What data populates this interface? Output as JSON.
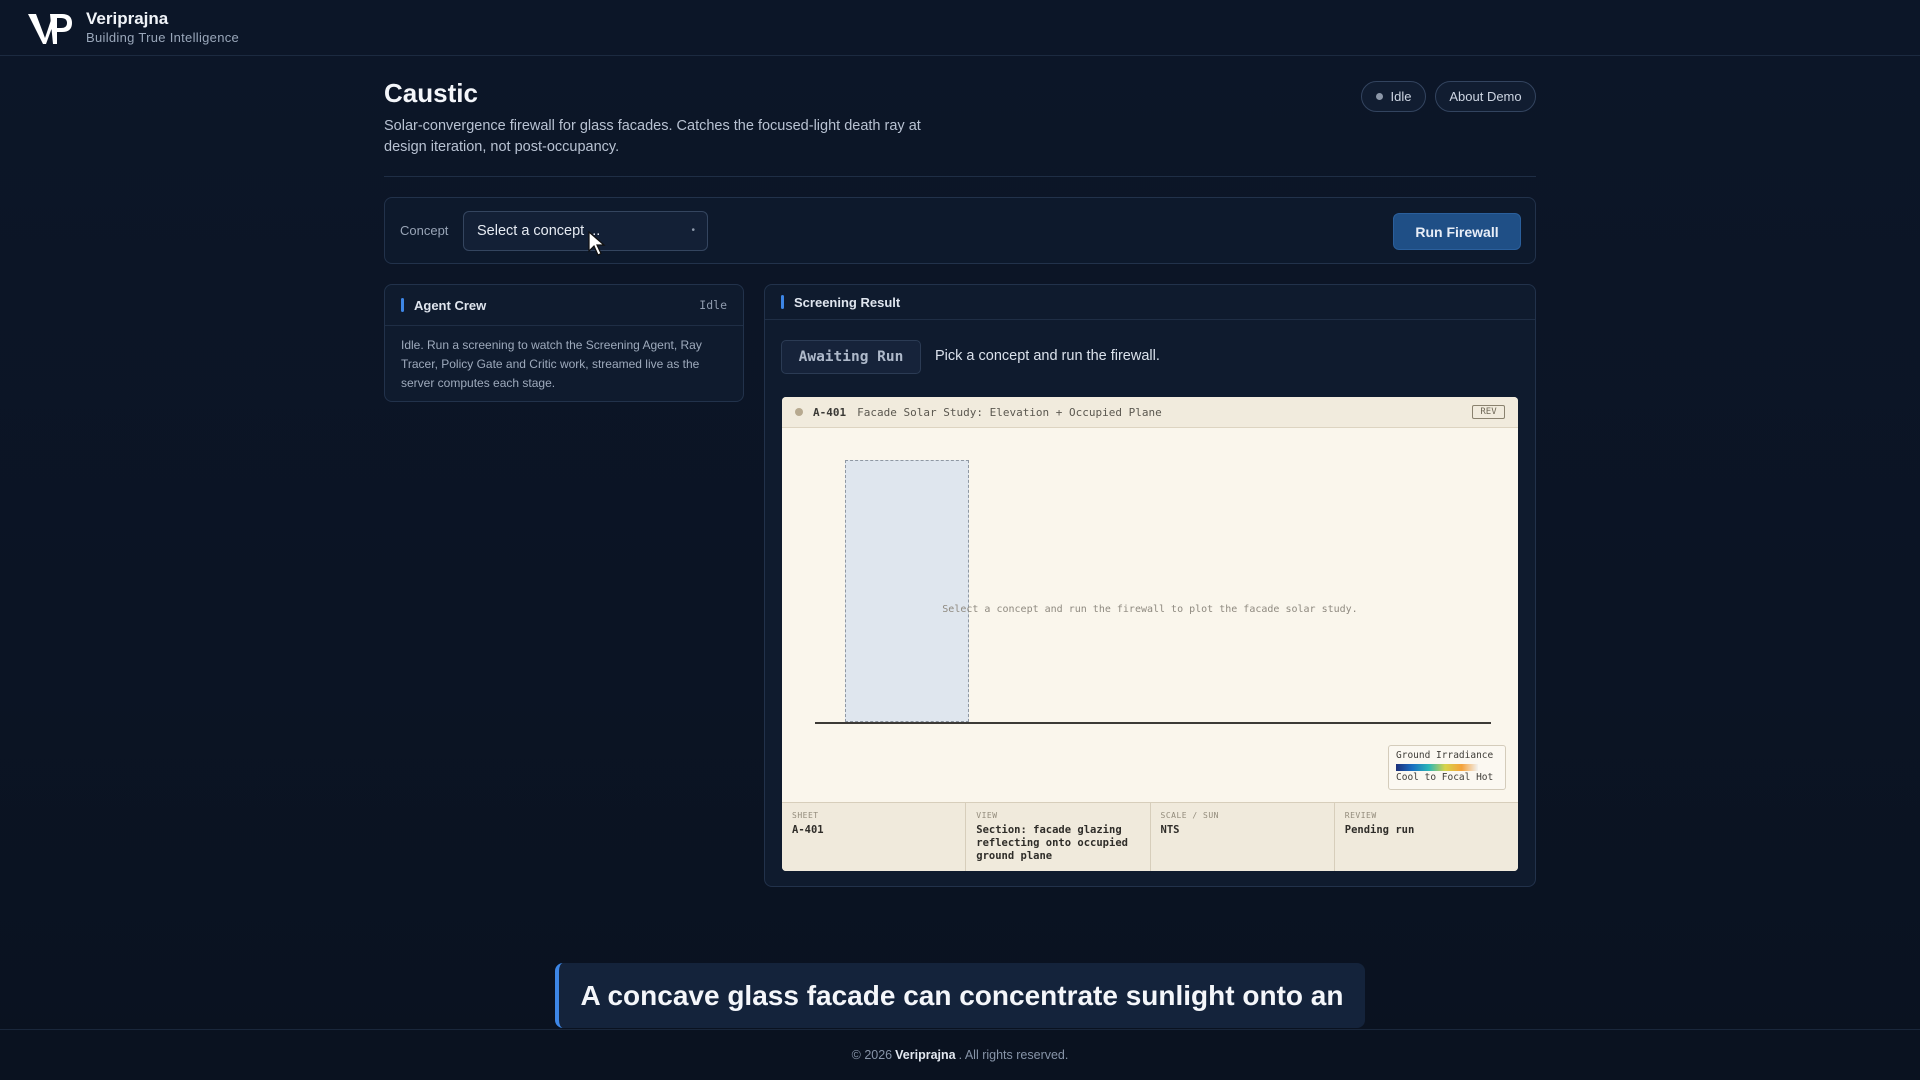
{
  "brand": {
    "name": "Veriprajna",
    "tagline": "Building True Intelligence"
  },
  "header": {
    "title": "Caustic",
    "description": "Solar-convergence firewall for glass facades. Catches the focused-light death ray at design iteration, not post-occupancy.",
    "status": "Idle",
    "about_label": "About Demo"
  },
  "concept": {
    "label": "Concept",
    "placeholder": "Select a concept ...",
    "run_label": "Run Firewall"
  },
  "agent_crew": {
    "title": "Agent Crew",
    "state": "Idle",
    "body": "Idle. Run a screening to watch the Screening Agent, Ray Tracer, Policy Gate and Critic work, streamed live as the server computes each stage."
  },
  "result": {
    "title": "Screening Result",
    "status_chip": "Awaiting Run",
    "status_text": "Pick a concept and run the firewall."
  },
  "sheet": {
    "id": "A-401",
    "title": "Facade Solar Study: Elevation + Occupied Plane",
    "rev": "REV",
    "placeholder": "Select a concept and run the firewall to plot the facade solar study.",
    "legend_title": "Ground Irradiance",
    "legend_range": "Cool to Focal Hot",
    "footer": [
      {
        "label": "SHEET",
        "value": "A-401"
      },
      {
        "label": "VIEW",
        "value": "Section: facade glazing reflecting onto occupied ground plane"
      },
      {
        "label": "SCALE / SUN",
        "value": "NTS"
      },
      {
        "label": "REVIEW",
        "value": "Pending run"
      }
    ]
  },
  "caption": "A concave glass facade can concentrate sunlight onto an",
  "footer": {
    "prefix": "© 2026",
    "brand": "Veriprajna",
    "suffix": ". All rights reserved."
  },
  "colors": {
    "accent": "#3d86e6",
    "run_button": "#1f4f86",
    "background": "#0b1424"
  }
}
